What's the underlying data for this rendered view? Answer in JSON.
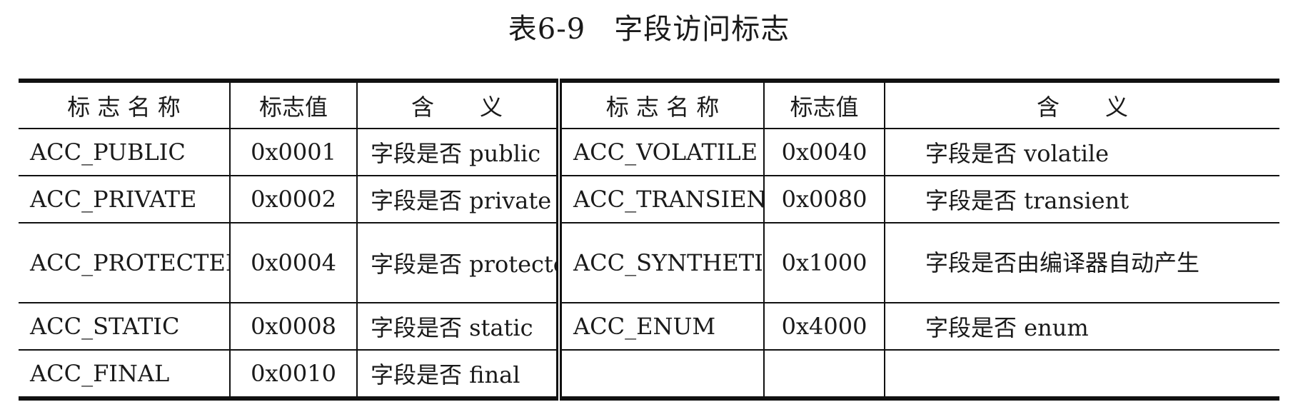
{
  "caption": {
    "number": "表6-9",
    "title": "字段访问标志"
  },
  "columns": [
    "标 志 名 称",
    "标志值",
    "含　　义",
    "标 志 名 称",
    "标志值",
    "含　　义"
  ],
  "rows": [
    {
      "l_name": "ACC_PUBLIC",
      "l_val": "0x0001",
      "l_mean": "字段是否 public",
      "r_name": "ACC_VOLATILE",
      "r_val": "0x0040",
      "r_mean": "字段是否 volatile"
    },
    {
      "l_name": "ACC_PRIVATE",
      "l_val": "0x0002",
      "l_mean": "字段是否 private",
      "r_name": "ACC_TRANSIENT",
      "r_val": "0x0080",
      "r_mean": "字段是否 transient"
    },
    {
      "l_name": "ACC_PROTECTED",
      "l_val": "0x0004",
      "l_mean": "字段是否 protected",
      "r_name": "ACC_SYNTHETIC",
      "r_val": "0x1000",
      "r_mean": "字段是否由编译器自动产生"
    },
    {
      "l_name": "ACC_STATIC",
      "l_val": "0x0008",
      "l_mean": "字段是否 static",
      "r_name": "ACC_ENUM",
      "r_val": "0x4000",
      "r_mean": "字段是否 enum"
    },
    {
      "l_name": "ACC_FINAL",
      "l_val": "0x0010",
      "l_mean": "字段是否 final",
      "r_name": "",
      "r_val": "",
      "r_mean": ""
    }
  ]
}
